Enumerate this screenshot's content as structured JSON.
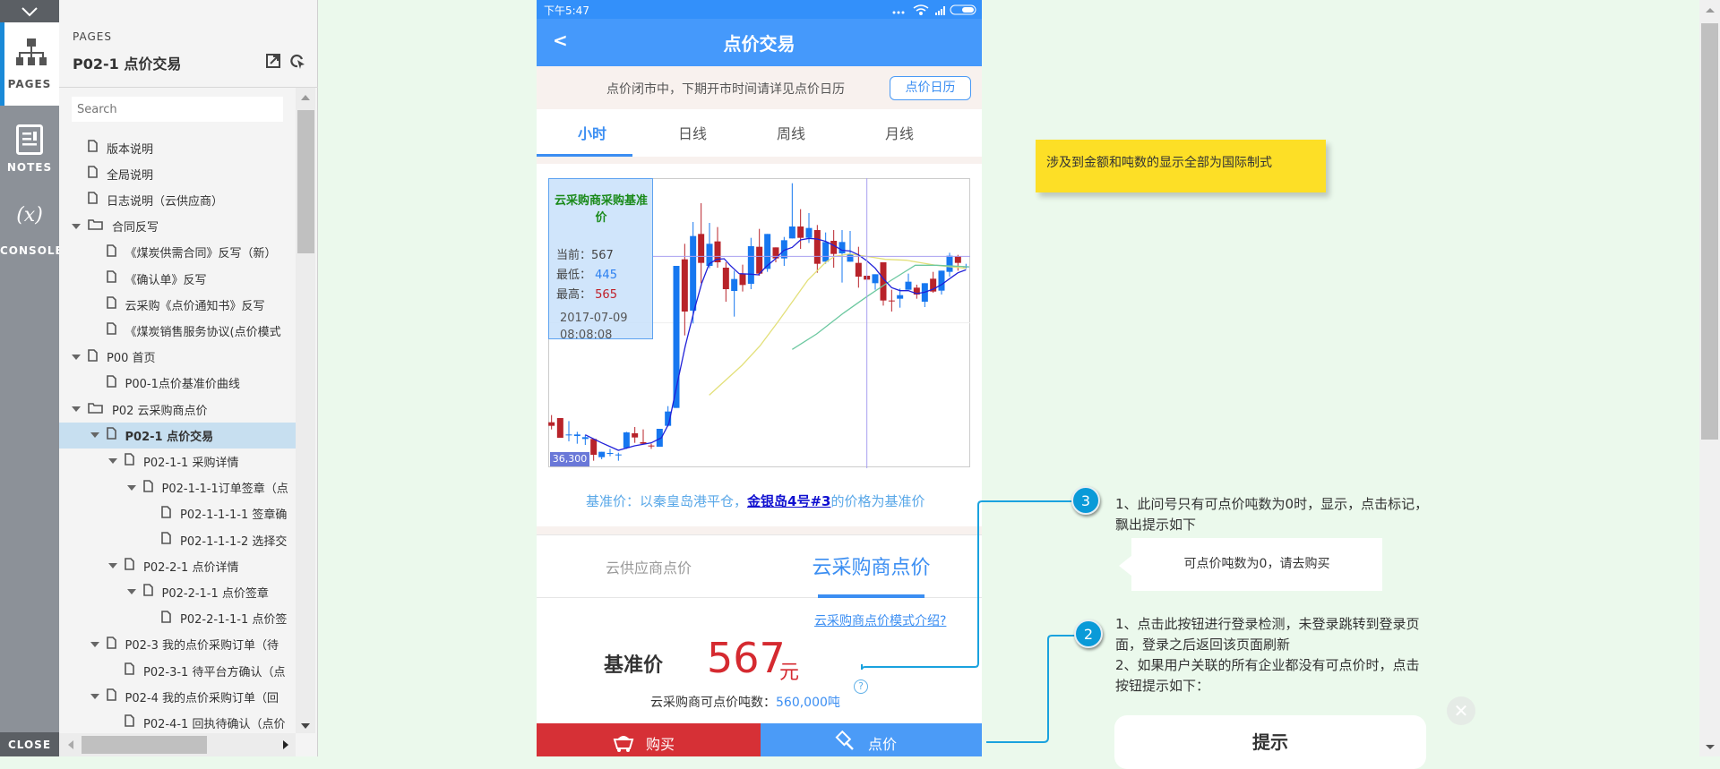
{
  "left_rail": {
    "collapse_icon": "chevron-down-icon",
    "pages_label": "PAGES",
    "notes_label": "NOTES",
    "console_symbol": "(x)",
    "console_label": "CONSOLE",
    "close_label": "CLOSE",
    "active_accent": "#1a8ad8"
  },
  "pages_panel": {
    "section_label": "PAGES",
    "title": "P02-1 点价交易",
    "search_placeholder": "Search",
    "tree": [
      {
        "label": "版本说明",
        "level": 0,
        "type": "page"
      },
      {
        "label": "全局说明",
        "level": 0,
        "type": "page"
      },
      {
        "label": "日志说明（云供应商）",
        "level": 0,
        "type": "page"
      },
      {
        "label": "合同反写",
        "level": 0,
        "type": "folder",
        "expanded": true
      },
      {
        "label": "《煤炭供需合同》反写（新）",
        "level": 1,
        "type": "page"
      },
      {
        "label": "《确认单》反写",
        "level": 1,
        "type": "page"
      },
      {
        "label": "云采购《点价通知书》反写",
        "level": 1,
        "type": "page"
      },
      {
        "label": "《煤炭销售服务协议(点价模式",
        "level": 1,
        "type": "page"
      },
      {
        "label": "P00 首页",
        "level": 0,
        "type": "page",
        "expanded": true
      },
      {
        "label": "P00-1点价基准价曲线",
        "level": 1,
        "type": "page"
      },
      {
        "label": "P02 云采购商点价",
        "level": 0,
        "type": "folder",
        "expanded": true
      },
      {
        "label": "P02-1 点价交易",
        "level": 1,
        "type": "page",
        "expanded": true,
        "selected": true
      },
      {
        "label": "P02-1-1 采购详情",
        "level": 2,
        "type": "page",
        "expanded": true
      },
      {
        "label": "P02-1-1-1订单签章（点",
        "level": 3,
        "type": "page",
        "expanded": true
      },
      {
        "label": "P02-1-1-1-1 签章确",
        "level": 4,
        "type": "page"
      },
      {
        "label": "P02-1-1-1-2 选择交",
        "level": 4,
        "type": "page"
      },
      {
        "label": "P02-2-1 点价详情",
        "level": 2,
        "type": "page",
        "expanded": true
      },
      {
        "label": "P02-2-1-1 点价签章",
        "level": 3,
        "type": "page",
        "expanded": true
      },
      {
        "label": "P02-2-1-1-1 点价签",
        "level": 4,
        "type": "page"
      },
      {
        "label": "P02-3 我的点价采购订单（待",
        "level": 1,
        "type": "page",
        "expanded": true
      },
      {
        "label": "P02-3-1 待平台方确认（点",
        "level": 2,
        "type": "page"
      },
      {
        "label": "P02-4 我的点价采购订单（回",
        "level": 1,
        "type": "page",
        "expanded": true
      },
      {
        "label": "P02-4-1 回执待确认（点价",
        "level": 2,
        "type": "page"
      }
    ]
  },
  "phone": {
    "status_bar": {
      "time": "下午5:47",
      "icons": [
        "more-dots-icon",
        "wifi-icon",
        "signal-icon",
        "battery-icon"
      ]
    },
    "header": {
      "back": "<",
      "title": "点价交易"
    },
    "notice": {
      "text": "点价闭市中，下期开市时间请详见点价日历",
      "button": "点价日历"
    },
    "tabs": [
      {
        "label": "小时",
        "active": true
      },
      {
        "label": "日线"
      },
      {
        "label": "周线"
      },
      {
        "label": "月线"
      }
    ],
    "chart": {
      "tooltip": {
        "title": "云采购商采购基准价",
        "current_label": "当前：",
        "current": "567",
        "low_label": "最低：",
        "low": "445",
        "high_label": "最高：",
        "high": "565",
        "date": "2017-07-09",
        "time": "08:08:08"
      },
      "axis_label": "36,300",
      "colors": {
        "up": "#b8232a",
        "down": "#1677f0",
        "ma_short": "#2020d8",
        "ma_mid": "#e3e07a",
        "ma_long": "#6cc8a0"
      }
    },
    "baseline": {
      "prefix": "基准价：以秦皇岛港平仓，",
      "link": "金银岛4号#3",
      "suffix": "的价格为基准价"
    },
    "sub_tabs": [
      {
        "label": "云供应商点价"
      },
      {
        "label": "云采购商点价",
        "active": true
      }
    ],
    "intro_link": "云采购商点价模式介绍?",
    "price": {
      "label": "基准价",
      "value": "567",
      "unit": "元"
    },
    "tonnage": {
      "label": "云采购商可点价吨数：",
      "value": "560,000吨"
    },
    "help_icon": "question-circle-icon",
    "buttons": {
      "buy": "购买",
      "spot": "点价"
    }
  },
  "annotations": {
    "note": "涉及到金额和吨数的显示全部为国际制式",
    "marker3": {
      "number": "3",
      "text": "1、此问号只有可点价吨数为0时，显示，点击标记，飘出提示如下",
      "tooltip": "可点价吨数为0，请去购买"
    },
    "marker2": {
      "number": "2",
      "line1": "1、点击此按钮进行登录检测，未登录跳转到登录页面，登录之后返回该页面刷新",
      "line2": "2、如果用户关联的所有企业都没有可点价时，点击按钮提示如下：",
      "dialog_title": "提示"
    }
  }
}
